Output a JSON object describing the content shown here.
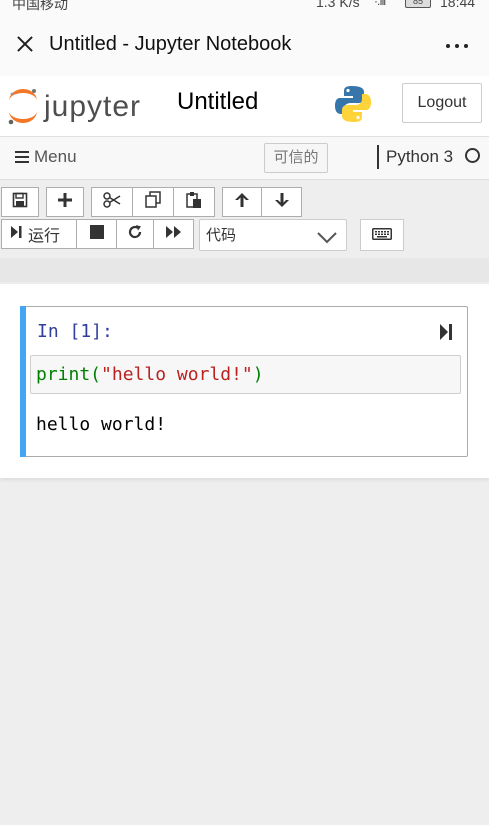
{
  "statusbar": {
    "carrier": "中国移动",
    "net_speed": "1.3 K/s",
    "signal": "·.ıll",
    "battery": "85",
    "time": "18:44"
  },
  "webview": {
    "title": "Untitled - Jupyter Notebook",
    "close_icon": "close-icon",
    "more_icon": "more-icon"
  },
  "header": {
    "logo_text": "jupyter",
    "notebook_name": "Untitled",
    "logout_label": "Logout"
  },
  "menubar": {
    "menu_label": "Menu",
    "trusted_label": "可信的",
    "kernel_name": "Python 3"
  },
  "toolbar": {
    "run_label": "运行",
    "cell_type": "代码",
    "icons": [
      "save-icon",
      "plus-icon",
      "scissors-icon",
      "copy-icon",
      "paste-icon",
      "arrow-up-icon",
      "arrow-down-icon",
      "step-forward-icon",
      "stop-icon",
      "refresh-icon",
      "fast-forward-icon",
      "chevron-down-icon",
      "keyboard-icon"
    ]
  },
  "cell": {
    "prompt": "In [1]:",
    "code_func": "print(",
    "code_string": "\"hello world!\"",
    "code_close": ")",
    "output": "hello world!"
  },
  "colors": {
    "cell_selected_bar": "#42a5f5",
    "prompt": "#303f9f",
    "keyword": "#008000",
    "string": "#ba2121"
  }
}
